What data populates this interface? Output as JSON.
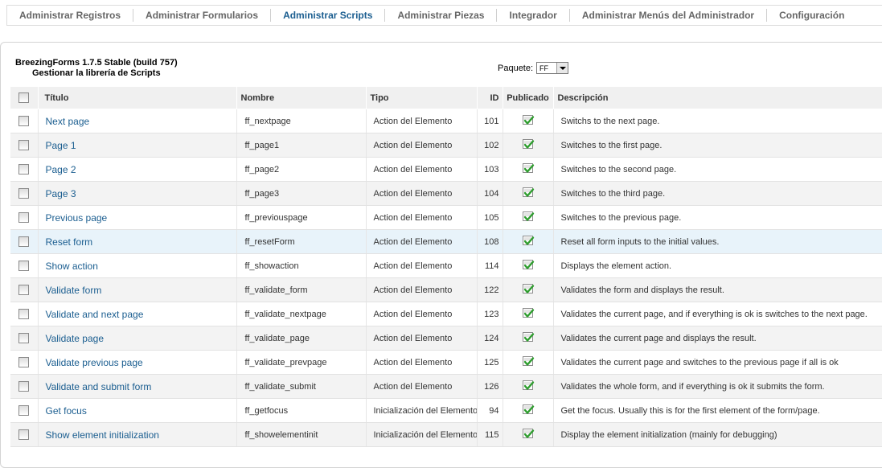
{
  "tabs": [
    {
      "label": "Administrar Registros"
    },
    {
      "label": "Administrar Formularios"
    },
    {
      "label": "Administrar Scripts"
    },
    {
      "label": "Administrar Piezas"
    },
    {
      "label": "Integrador"
    },
    {
      "label": "Administrar Menús del Administrador"
    },
    {
      "label": "Configuración"
    }
  ],
  "active_tab": "Administrar Scripts",
  "header": {
    "title": "BreezingForms 1.7.5 Stable (build 757)",
    "subtitle": "Gestionar la librería de Scripts"
  },
  "package_filter": {
    "label": "Paquete:",
    "value": "FF"
  },
  "table": {
    "columns": {
      "title": "Título",
      "name": "Nombre",
      "type": "Tipo",
      "id": "ID",
      "published": "Publicado",
      "description": "Descripción"
    },
    "rows": [
      {
        "title": "Next page",
        "name": "ff_nextpage",
        "type": "Action del Elemento",
        "id": "101",
        "published": true,
        "description": "Switchs to the next page."
      },
      {
        "title": "Page 1",
        "name": "ff_page1",
        "type": "Action del Elemento",
        "id": "102",
        "published": true,
        "description": "Switches to the first page."
      },
      {
        "title": "Page 2",
        "name": "ff_page2",
        "type": "Action del Elemento",
        "id": "103",
        "published": true,
        "description": "Switches to the second page."
      },
      {
        "title": "Page 3",
        "name": "ff_page3",
        "type": "Action del Elemento",
        "id": "104",
        "published": true,
        "description": "Switches to the third page."
      },
      {
        "title": "Previous page",
        "name": "ff_previouspage",
        "type": "Action del Elemento",
        "id": "105",
        "published": true,
        "description": "Switches to the previous page."
      },
      {
        "title": "Reset form",
        "name": "ff_resetForm",
        "type": "Action del Elemento",
        "id": "108",
        "published": true,
        "description": "Reset all form inputs to the initial values."
      },
      {
        "title": "Show action",
        "name": "ff_showaction",
        "type": "Action del Elemento",
        "id": "114",
        "published": true,
        "description": "Displays the element action."
      },
      {
        "title": "Validate form",
        "name": "ff_validate_form",
        "type": "Action del Elemento",
        "id": "122",
        "published": true,
        "description": "Validates the form and displays the result."
      },
      {
        "title": "Validate and next page",
        "name": "ff_validate_nextpage",
        "type": "Action del Elemento",
        "id": "123",
        "published": true,
        "description": "Validates the current page, and if everything is ok is switches to the next page."
      },
      {
        "title": "Validate page",
        "name": "ff_validate_page",
        "type": "Action del Elemento",
        "id": "124",
        "published": true,
        "description": "Validates the current page and displays the result."
      },
      {
        "title": "Validate previous page",
        "name": "ff_validate_prevpage",
        "type": "Action del Elemento",
        "id": "125",
        "published": true,
        "description": "Validates the current page and switches to the previous page if all is ok"
      },
      {
        "title": "Validate and submit form",
        "name": "ff_validate_submit",
        "type": "Action del Elemento",
        "id": "126",
        "published": true,
        "description": "Validates the whole form, and if everything is ok it submits the form."
      },
      {
        "title": "Get focus",
        "name": "ff_getfocus",
        "type": "Inicialización del Elemento",
        "id": "94",
        "published": true,
        "description": "Get the focus. Usually this is for the first element of the form/page."
      },
      {
        "title": "Show element initialization",
        "name": "ff_showelementinit",
        "type": "Inicialización del Elemento",
        "id": "115",
        "published": true,
        "description": "Display the element initialization (mainly for debugging)"
      }
    ]
  },
  "colors": {
    "link": "#1b5e90",
    "active_tab": "#1b5e90",
    "row_alt": "#f3f3f3",
    "row_highlight": "#e8f3fa"
  }
}
